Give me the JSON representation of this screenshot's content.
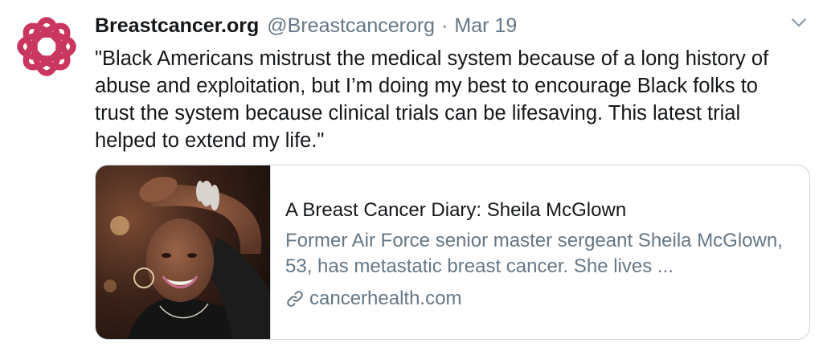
{
  "tweet": {
    "author": {
      "display_name": "Breastcancer.org",
      "handle": "@Breastcancerorg",
      "separator": "·",
      "date": "Mar 19",
      "avatar_icon": "breastcancer-org-logo",
      "brand_color": "#c9375e"
    },
    "menu_icon": "chevron-down-icon",
    "text": "\"Black Americans mistrust the medical system because of a long history of abuse and exploitation, but I’m doing my best to encourage Black folks to trust the system because clinical trials can be lifesaving. This latest trial helped to extend my life.\"",
    "card": {
      "title": "A Breast Cancer Diary: Sheila McGlown",
      "description": "Former Air Force senior master sergeant Sheila McGlown, 53, has metastatic breast cancer. She lives ...",
      "domain": "cancerhealth.com",
      "link_icon": "link-icon"
    }
  }
}
